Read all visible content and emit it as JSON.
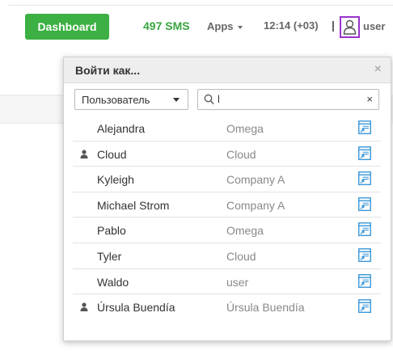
{
  "header": {
    "dashboard_label": "Dashboard",
    "sms_label": "497 SMS",
    "apps_label": "Apps",
    "time_label": "12:14 (+03)",
    "separator": "|",
    "user_label": "user"
  },
  "dialog": {
    "title": "Войти как...",
    "close_symbol": "×",
    "filter": {
      "selected": "Пользователь"
    },
    "search": {
      "value": "l",
      "clear_symbol": "×"
    },
    "rows": [
      {
        "name": "Alejandra",
        "company": "Omega",
        "marked": false
      },
      {
        "name": "Cloud",
        "company": "Cloud",
        "marked": true
      },
      {
        "name": "Kyleigh",
        "company": "Company A",
        "marked": false
      },
      {
        "name": "Michael Strom",
        "company": "Company A",
        "marked": false
      },
      {
        "name": "Pablo",
        "company": "Omega",
        "marked": false
      },
      {
        "name": "Tyler",
        "company": "Cloud",
        "marked": false
      },
      {
        "name": "Waldo",
        "company": "user",
        "marked": false
      },
      {
        "name": "Úrsula Buendía",
        "company": "Úrsula Buendía",
        "marked": true
      }
    ]
  },
  "icons": {
    "user": "user-outline-icon",
    "marker": "person-icon",
    "action": "login-as-icon",
    "search": "search-icon"
  },
  "colors": {
    "dashboard_bg": "#3cb043",
    "sms_text": "#3aa53f",
    "highlight_border": "#9933cc",
    "action_icon": "#2b8fd6"
  }
}
